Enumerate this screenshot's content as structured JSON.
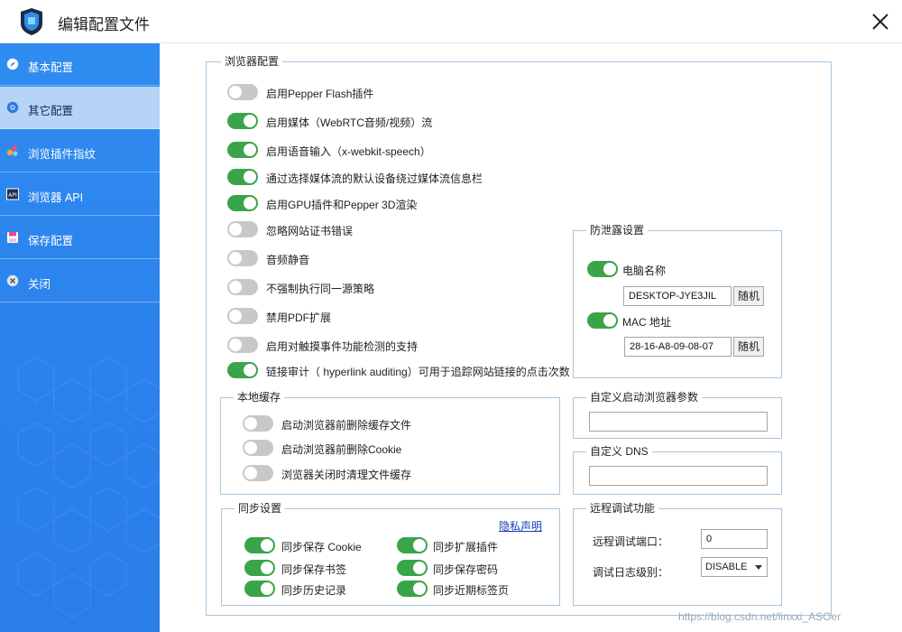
{
  "window": {
    "title": "编辑配置文件"
  },
  "sidebar": {
    "items": [
      {
        "label": "基本配置",
        "icon": "compass-icon",
        "active": false
      },
      {
        "label": "其它配置",
        "icon": "chrome-icon",
        "active": true
      },
      {
        "label": "浏览插件指纹",
        "icon": "plugin-icon",
        "active": false
      },
      {
        "label": "浏览器 API",
        "icon": "api-icon",
        "active": false
      },
      {
        "label": "保存配置",
        "icon": "save-icon",
        "active": false
      },
      {
        "label": "关闭",
        "icon": "close-circle-icon",
        "active": false
      }
    ]
  },
  "browser_config": {
    "legend": "浏览器配置",
    "options": [
      {
        "label": "启用Pepper Flash插件",
        "on": false
      },
      {
        "label": "启用媒体（WebRTC音频/视频）流",
        "on": true
      },
      {
        "label": "启用语音输入（x-webkit-speech）",
        "on": true
      },
      {
        "label": "通过选择媒体流的默认设备绕过媒体流信息栏",
        "on": true
      },
      {
        "label": "启用GPU插件和Pepper 3D渲染",
        "on": true
      },
      {
        "label": "忽略网站证书错误",
        "on": false
      },
      {
        "label": "音频静音",
        "on": false
      },
      {
        "label": "不强制执行同一源策略",
        "on": false
      },
      {
        "label": "禁用PDF扩展",
        "on": false
      },
      {
        "label": "启用对触摸事件功能检测的支持",
        "on": false
      },
      {
        "label": "链接审计（ hyperlink auditing）可用于追踪网站链接的点击次数",
        "on": true
      }
    ]
  },
  "anti_leak": {
    "legend": "防泄露设置",
    "computer_name_label": "电脑名称",
    "computer_name_on": true,
    "computer_name_value": "DESKTOP-JYE3JIL",
    "mac_label": "MAC 地址",
    "mac_on": true,
    "mac_value": "28-16-A8-09-08-07",
    "random_label": "随机"
  },
  "local_cache": {
    "legend": "本地缓存",
    "options": [
      {
        "label": "启动浏览器前删除缓存文件",
        "on": false
      },
      {
        "label": "启动浏览器前删除Cookie",
        "on": false
      },
      {
        "label": "浏览器关闭时清理文件缓存",
        "on": false
      }
    ]
  },
  "custom_args": {
    "legend": "自定义启动浏览器参数",
    "value": ""
  },
  "custom_dns": {
    "legend": "自定义 DNS",
    "value": ""
  },
  "sync": {
    "legend": "同步设置",
    "privacy_link": "隐私声明",
    "options": [
      {
        "label": "同步保存 Cookie",
        "on": true
      },
      {
        "label": "同步扩展插件",
        "on": true
      },
      {
        "label": "同步保存书签",
        "on": true
      },
      {
        "label": "同步保存密码",
        "on": true
      },
      {
        "label": "同步历史记录",
        "on": true
      },
      {
        "label": "同步近期标签页",
        "on": true
      }
    ]
  },
  "remote_debug": {
    "legend": "远程调试功能",
    "port_label": "远程调试端口：",
    "port_value": "0",
    "log_label": "调试日志级别：",
    "log_value": "DISABLE"
  },
  "watermark": "https://blog.csdn.net/linxxi_ASOer",
  "colors": {
    "sidebar": "#2b86ee",
    "toggle_on": "#3aa449",
    "toggle_off": "#c8c8c8",
    "border": "#a8c5dd"
  }
}
